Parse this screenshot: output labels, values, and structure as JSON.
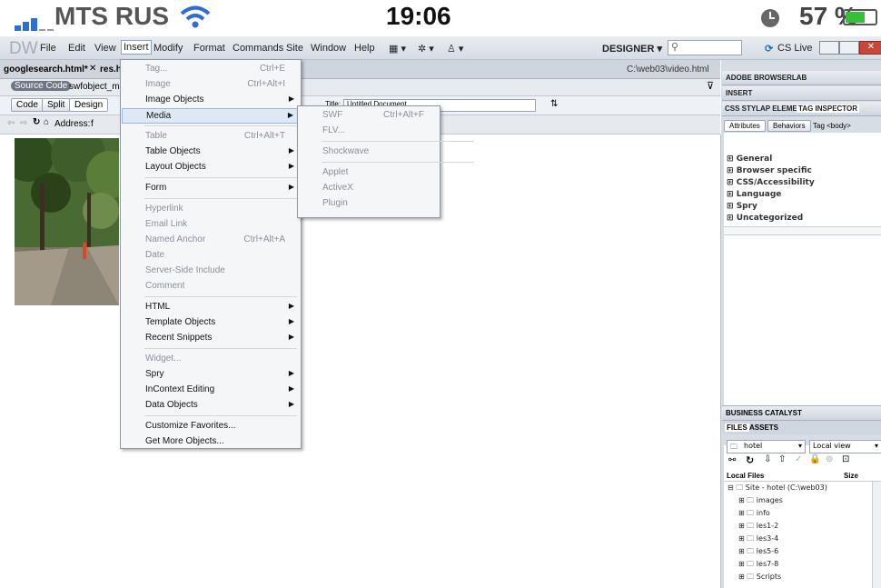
{
  "status_bar": {
    "carrier": "MTS RUS",
    "time": "19:06",
    "battery": "57 %"
  },
  "app": {
    "logo": "DW",
    "menus": [
      "File",
      "Edit",
      "View",
      "Insert",
      "Modify",
      "Format",
      "Commands",
      "Site",
      "Window",
      "Help"
    ],
    "workspace": "DESIGNER ▾",
    "cslive": "CS Live"
  },
  "doc": {
    "tabs": [
      "googlesearch.html*",
      "res.h"
    ],
    "path": "C:\\web03\\video.html",
    "related": [
      "Source Code",
      "swfobject_mod"
    ],
    "views": [
      "Code",
      "Split",
      "Design"
    ],
    "title_label": "Title:",
    "title_value": "Untitled Document",
    "address_label": "Address:",
    "address_value": "f"
  },
  "insert_menu": [
    {
      "label": "Tag...",
      "shortcut": "Ctrl+E",
      "enabled": false
    },
    {
      "label": "Image",
      "shortcut": "Ctrl+Alt+I",
      "enabled": false
    },
    {
      "label": "Image Objects",
      "submenu": true,
      "enabled": true
    },
    {
      "label": "Media",
      "submenu": true,
      "enabled": true,
      "highlighted": true
    },
    {
      "sep": true
    },
    {
      "label": "Table",
      "shortcut": "Ctrl+Alt+T",
      "enabled": false
    },
    {
      "label": "Table Objects",
      "submenu": true,
      "enabled": true
    },
    {
      "label": "Layout Objects",
      "submenu": true,
      "enabled": true
    },
    {
      "sep": true
    },
    {
      "label": "Form",
      "submenu": true,
      "enabled": true
    },
    {
      "sep": true
    },
    {
      "label": "Hyperlink",
      "enabled": false
    },
    {
      "label": "Email Link",
      "enabled": false
    },
    {
      "label": "Named Anchor",
      "shortcut": "Ctrl+Alt+A",
      "enabled": false
    },
    {
      "label": "Date",
      "enabled": false
    },
    {
      "label": "Server-Side Include",
      "enabled": false
    },
    {
      "label": "Comment",
      "enabled": false
    },
    {
      "sep": true
    },
    {
      "label": "HTML",
      "submenu": true,
      "enabled": true
    },
    {
      "label": "Template Objects",
      "submenu": true,
      "enabled": true
    },
    {
      "label": "Recent Snippets",
      "submenu": true,
      "enabled": true
    },
    {
      "sep": true
    },
    {
      "label": "Widget...",
      "enabled": false
    },
    {
      "label": "Spry",
      "submenu": true,
      "enabled": true
    },
    {
      "label": "InContext Editing",
      "submenu": true,
      "enabled": true
    },
    {
      "label": "Data Objects",
      "submenu": true,
      "enabled": true
    },
    {
      "sep": true
    },
    {
      "label": "Customize Favorites...",
      "enabled": true
    },
    {
      "label": "Get More Objects...",
      "enabled": true
    }
  ],
  "media_menu": [
    {
      "label": "SWF",
      "shortcut": "Ctrl+Alt+F"
    },
    {
      "label": "FLV..."
    },
    {
      "sep": true
    },
    {
      "label": "Shockwave"
    },
    {
      "sep": true
    },
    {
      "label": "Applet"
    },
    {
      "label": "ActiveX"
    },
    {
      "label": "Plugin"
    }
  ],
  "right_panel": {
    "browserlab": "ADOBE BROWSERLAB",
    "insert": "INSERT",
    "css_tabs": [
      "CSS STYL",
      "AP ELEME",
      "TAG INSPECTOR"
    ],
    "subtabs": [
      "Attributes",
      "Behaviors",
      "Tag <body>"
    ],
    "categories": [
      "General",
      "Browser specific",
      "CSS/Accessibility",
      "Language",
      "Spry",
      "Uncategorized"
    ],
    "business": "BUSINESS CATALYST",
    "files_tabs": [
      "FILES",
      "ASSETS"
    ],
    "site_select": "hotel",
    "view_select": "Local view",
    "columns": [
      "Local Files",
      "Size"
    ],
    "tree": [
      "Site - hotel (C:\\web03)",
      "images",
      "info",
      "les1-2",
      "les3-4",
      "les5-6",
      "les7-8",
      "Scripts"
    ]
  }
}
